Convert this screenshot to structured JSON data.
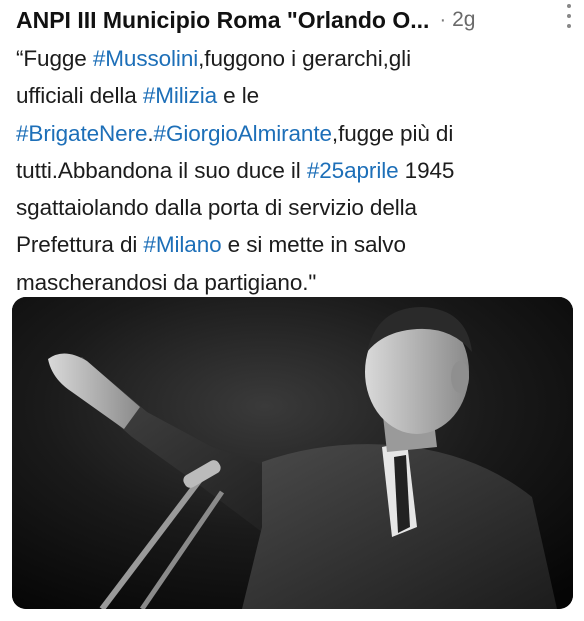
{
  "post": {
    "author": "ANPI III Municipio Roma \"Orlando O...",
    "separator": "·",
    "time": "2g",
    "lines": [
      [
        {
          "t": "“Fugge "
        },
        {
          "t": "#Mussolini",
          "tag": true
        },
        {
          "t": ",fuggono i gerarchi,gli"
        }
      ],
      [
        {
          "t": "ufficiali della "
        },
        {
          "t": "#Milizia",
          "tag": true
        },
        {
          "t": " e le"
        }
      ],
      [
        {
          "t": "#BrigateNere",
          "tag": true
        },
        {
          "t": "."
        },
        {
          "t": "#GiorgioAlmirante",
          "tag": true
        },
        {
          "t": ",fugge più di"
        }
      ],
      [
        {
          "t": "tutti.Abbandona il suo duce il "
        },
        {
          "t": "#25aprile",
          "tag": true
        },
        {
          "t": " 1945"
        }
      ],
      [
        {
          "t": "sgattaiolando dalla porta di servizio della"
        }
      ],
      [
        {
          "t": "Prefettura di "
        },
        {
          "t": "#Milano",
          "tag": true
        },
        {
          "t": " e si mette in salvo"
        }
      ],
      [
        {
          "t": "mascherandosi da partigiano.\""
        }
      ]
    ]
  },
  "colors": {
    "hashtag": "#1d6fb8",
    "text": "#1c1c1c",
    "meta": "#6a6a6a",
    "photo_bg": "#0a0a0a"
  },
  "icons": {
    "menu": "vertical-dots-icon"
  }
}
